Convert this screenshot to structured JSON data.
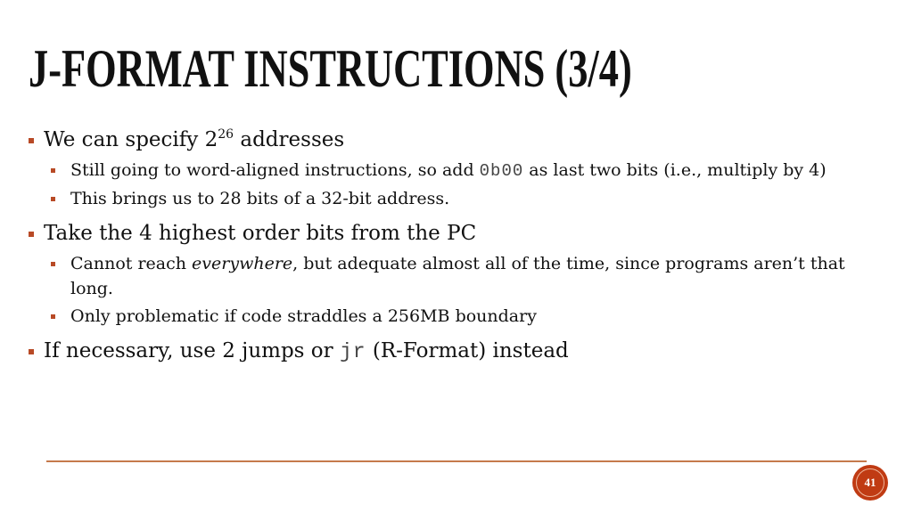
{
  "slide": {
    "title": "J-Format Instructions (3/4)",
    "page_number": "41",
    "accent_color": "#b84a26",
    "rule_color": "#c57a4c",
    "badge_color": "#c03b13"
  },
  "bullets": [
    {
      "text_before": "We can specify 2",
      "superscript": "26",
      "text_after": " addresses",
      "sub": [
        {
          "text_before": "Still going to word-aligned instructions, so add ",
          "code": "0b00",
          "text_after": " as last two bits (i.e., multiply by 4)"
        },
        {
          "text": "This brings us to 28 bits of a 32-bit address."
        }
      ]
    },
    {
      "text": "Take the 4 highest order bits from the PC",
      "sub": [
        {
          "text_before": "Cannot reach ",
          "emphasis": "everywhere",
          "text_after": ", but adequate almost all of the time, since programs aren’t that long."
        },
        {
          "text": "Only problematic if code straddles a 256MB boundary"
        }
      ]
    },
    {
      "text_before": "If necessary, use 2 jumps or ",
      "code": "jr",
      "text_after": " (R-Format) instead"
    }
  ]
}
